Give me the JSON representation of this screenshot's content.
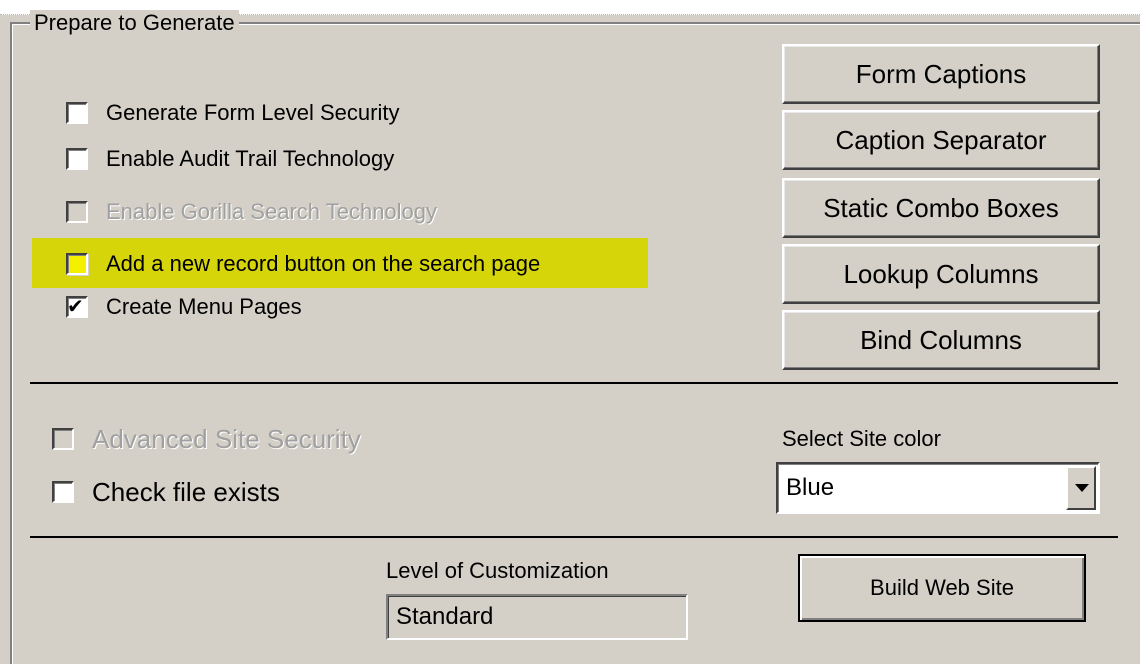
{
  "group_title": "Prepare to Generate",
  "checkboxes": [
    {
      "label": "Generate Form Level Security",
      "checked": false,
      "enabled": true,
      "highlighted": false
    },
    {
      "label": "Enable Audit Trail Technology",
      "checked": false,
      "enabled": true,
      "highlighted": false
    },
    {
      "label": "Enable Gorilla Search Technology",
      "checked": false,
      "enabled": false,
      "highlighted": false
    },
    {
      "label": "Add a new record button on the search page",
      "checked": false,
      "enabled": true,
      "highlighted": true
    },
    {
      "label": "Create Menu Pages",
      "checked": true,
      "enabled": true,
      "highlighted": false
    }
  ],
  "buttons": {
    "form_captions": "Form Captions",
    "caption_separator": "Caption Separator",
    "static_combo_boxes": "Static Combo Boxes",
    "lookup_columns": "Lookup Columns",
    "bind_columns": "Bind Columns"
  },
  "advanced_site_security": {
    "label": "Advanced Site Security",
    "checked": false,
    "enabled": false
  },
  "check_file_exists": {
    "label": "Check file exists",
    "checked": false,
    "enabled": true
  },
  "site_color": {
    "label": "Select Site color",
    "value": "Blue"
  },
  "customization": {
    "label": "Level of Customization",
    "value": "Standard"
  },
  "build_button": "Build Web Site",
  "check_mark": "✔",
  "colors": {
    "face": "#d4d0c8",
    "highlight": "#d6d50a",
    "disabled_text": "#a0a0a0"
  },
  "icons": {
    "dropdown_arrow": "chevron-down-icon",
    "check": "check-icon"
  }
}
